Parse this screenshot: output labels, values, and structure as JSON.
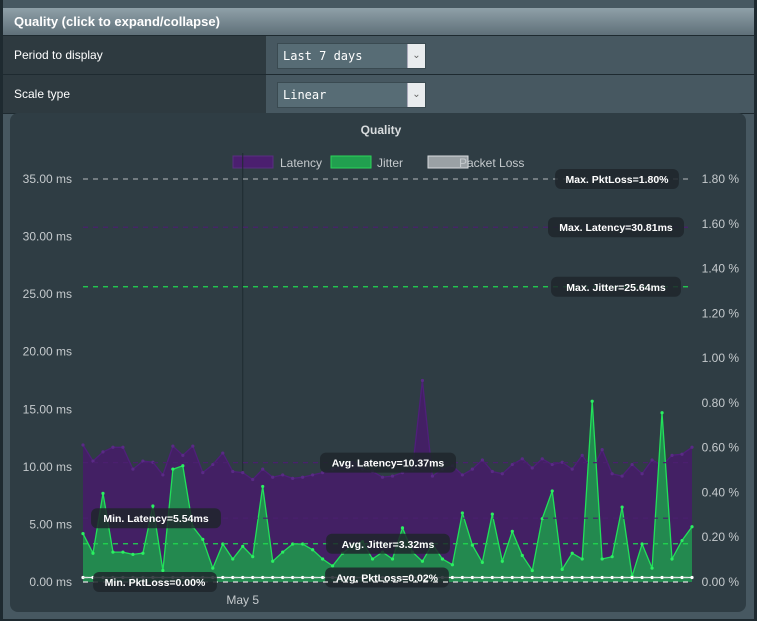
{
  "section": {
    "title": "Quality (click to expand/collapse)"
  },
  "settings": [
    {
      "label": "Period to display",
      "value": "Last 7 days"
    },
    {
      "label": "Scale type",
      "value": "Linear"
    }
  ],
  "chart_data": {
    "type": "area",
    "title": "Quality",
    "legend": [
      {
        "name": "Latency",
        "color": "#4b1f6f"
      },
      {
        "name": "Jitter",
        "color": "#21a04f"
      },
      {
        "name": "Packet Loss",
        "color": "#9aa1a5"
      }
    ],
    "legend_position": "top",
    "y_left": {
      "unit": "ms",
      "ylim": [
        0,
        35
      ],
      "ticks": [
        "0.00 ms",
        "5.00 ms",
        "10.00 ms",
        "15.00 ms",
        "20.00 ms",
        "25.00 ms",
        "30.00 ms",
        "35.00 ms"
      ]
    },
    "y_right": {
      "unit": "%",
      "ylim": [
        0,
        1.8
      ],
      "ticks": [
        "0.00 %",
        "0.20 %",
        "0.40 %",
        "0.60 %",
        "0.80 %",
        "1.00 %",
        "1.20 %",
        "1.40 %",
        "1.60 %",
        "1.80 %"
      ]
    },
    "x_ticks": [
      {
        "label": "May 5",
        "index": 16
      }
    ],
    "series": [
      {
        "name": "Latency",
        "values": [
          11.9,
          10.5,
          11.3,
          11.7,
          11.7,
          9.8,
          10.5,
          10.4,
          9.3,
          11.8,
          11.0,
          11.8,
          9.5,
          10.2,
          11.2,
          9.6,
          9.5,
          8.9,
          9.8,
          9.1,
          9.3,
          9.0,
          9.1,
          9.3,
          9.5,
          9.8,
          10.1,
          10.4,
          9.8,
          9.6,
          9.1,
          9.2,
          9.5,
          9.8,
          17.5,
          9.2,
          9.8,
          10.1,
          9.3,
          9.8,
          10.6,
          9.6,
          9.4,
          10.2,
          10.7,
          9.9,
          10.7,
          10.2,
          10.4,
          9.8,
          11.0,
          9.7,
          11.5,
          9.4,
          9.2,
          10.2,
          9.4,
          10.6,
          10.1,
          11.0,
          11.1,
          11.7
        ]
      },
      {
        "name": "Jitter",
        "values": [
          4.2,
          2.5,
          7.7,
          2.6,
          2.6,
          2.4,
          2.5,
          6.6,
          1.0,
          9.8,
          10.1,
          4.8,
          3.7,
          1.2,
          3.3,
          2.0,
          3.1,
          2.2,
          8.3,
          1.8,
          2.6,
          3.3,
          3.3,
          2.8,
          2.0,
          1.4,
          2.5,
          3.2,
          3.5,
          2.0,
          2.6,
          2.0,
          4.7,
          2.6,
          1.8,
          3.3,
          2.0,
          1.5,
          6.0,
          3.2,
          1.7,
          5.9,
          1.8,
          4.4,
          2.3,
          1.0,
          5.5,
          7.9,
          1.1,
          2.5,
          2.0,
          15.7,
          2.0,
          2.2,
          6.5,
          0.5,
          3.3,
          1.2,
          14.7,
          2.0,
          3.6,
          4.8
        ]
      },
      {
        "name": "Packet Loss",
        "values": [
          0.02,
          0.02,
          0.02,
          0.02,
          0.02,
          0.02,
          0.02,
          0.02,
          0.02,
          0.02,
          0.02,
          0.02,
          0.02,
          0.02,
          0.02,
          0.02,
          0.02,
          0.02,
          0.02,
          0.02,
          0.02,
          0.02,
          0.02,
          0.02,
          0.02,
          0.02,
          0.02,
          0.02,
          0.02,
          0.02,
          0.02,
          0.02,
          0.02,
          0.02,
          0.02,
          0.02,
          0.02,
          0.02,
          0.02,
          0.02,
          0.02,
          0.02,
          0.02,
          0.02,
          0.02,
          0.02,
          0.02,
          0.02,
          0.02,
          0.02,
          0.02,
          0.02,
          0.02,
          0.02,
          0.02,
          0.02,
          0.02,
          0.02,
          0.02,
          0.02,
          0.02,
          0.02
        ]
      }
    ],
    "annotations": [
      {
        "label": "Max. PktLoss=1.80%",
        "axis": "right",
        "value": 1.8,
        "color": "#9aa1a5"
      },
      {
        "label": "Max. Latency=30.81ms",
        "axis": "left",
        "value": 30.81,
        "color": "#4b1f6f"
      },
      {
        "label": "Max. Jitter=25.64ms",
        "axis": "left",
        "value": 25.64,
        "color": "#21d94f"
      },
      {
        "label": "Avg. Latency=10.37ms",
        "axis": "left",
        "value": 10.37,
        "color": "#4b1f6f"
      },
      {
        "label": "Min. Latency=5.54ms",
        "axis": "left",
        "value": 5.54,
        "color": "#4b1f6f"
      },
      {
        "label": "Avg. Jitter=3.32ms",
        "axis": "left",
        "value": 3.32,
        "color": "#21d94f"
      },
      {
        "label": "Avg. PktLoss=0.02%",
        "axis": "right",
        "value": 0.02,
        "color": "#e0e0e0"
      },
      {
        "label": "Min. PktLoss=0.00%",
        "axis": "right",
        "value": 0.0,
        "color": "#e0e0e0"
      }
    ]
  }
}
